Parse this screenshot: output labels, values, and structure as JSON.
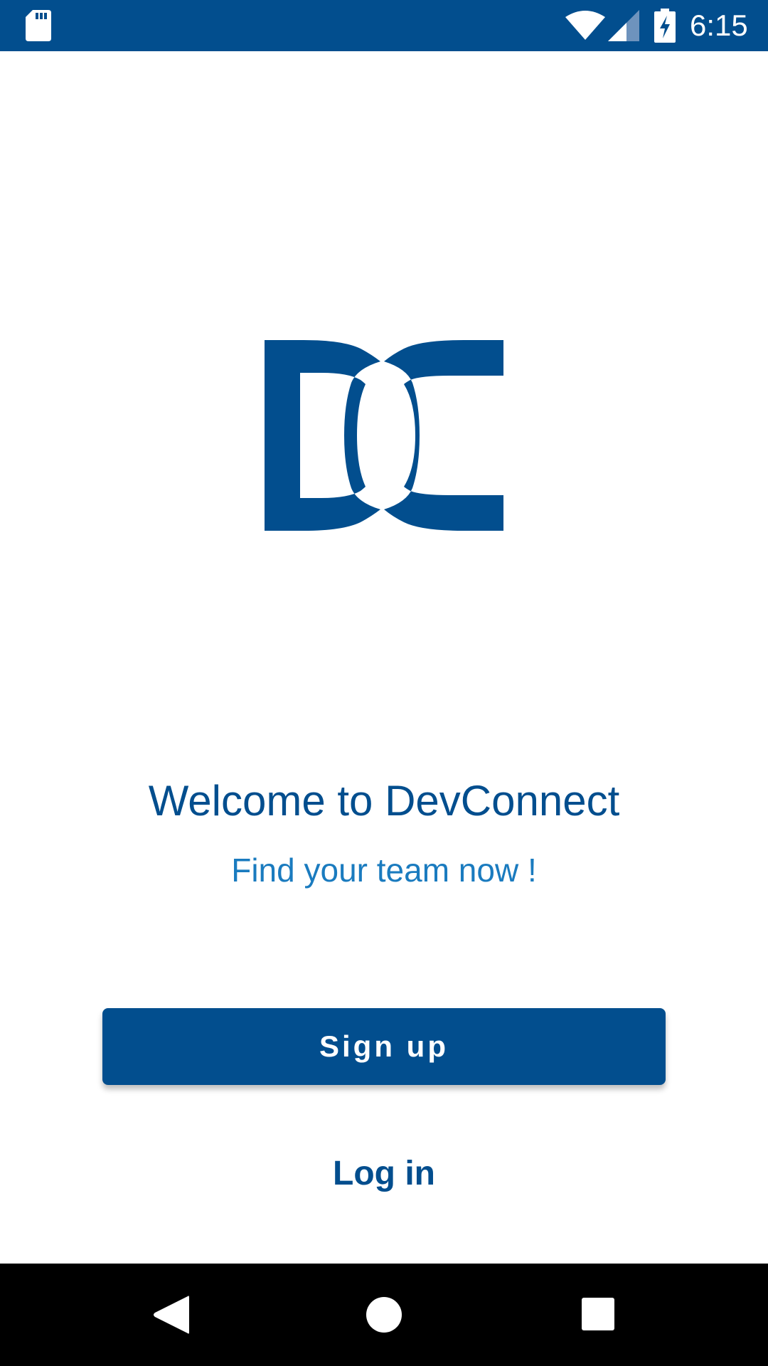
{
  "status_bar": {
    "time": "6:15",
    "icons": [
      "sd-card-icon",
      "wifi-icon",
      "signal-icon",
      "battery-charging-icon"
    ],
    "background_color": "#024E8E"
  },
  "logo": {
    "text": "DC",
    "color": "#024E8E"
  },
  "welcome": {
    "title": "Welcome to DevConnect",
    "subtitle": "Find your team now !"
  },
  "actions": {
    "signup_label": "Sign up",
    "login_label": "Log in"
  },
  "nav_bar": {
    "icons": [
      "back-icon",
      "home-icon",
      "recents-icon"
    ]
  },
  "colors": {
    "primary": "#024E8E",
    "accent": "#1A7BBF",
    "background": "#FFFFFF"
  }
}
